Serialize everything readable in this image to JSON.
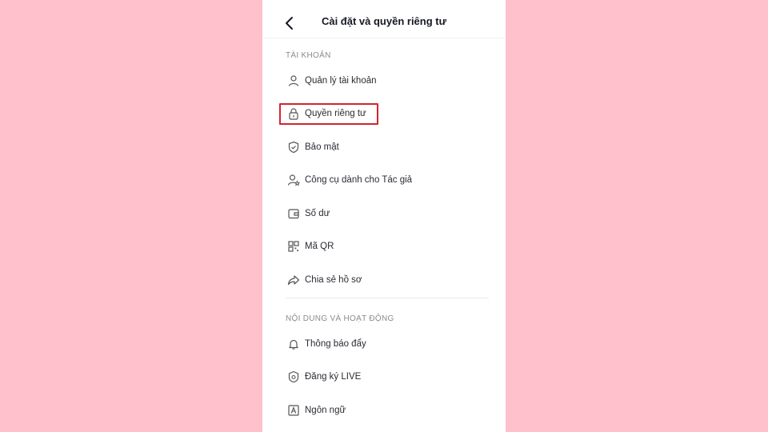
{
  "header": {
    "title": "Cài đặt và quyền riêng tư"
  },
  "sections": [
    {
      "title": "TÀI KHOẢN",
      "items": [
        {
          "label": "Quản lý tài khoản",
          "icon": "person-icon"
        },
        {
          "label": "Quyền riêng tư",
          "icon": "lock-icon"
        },
        {
          "label": "Bảo mật",
          "icon": "shield-icon"
        },
        {
          "label": "Công cụ dành cho Tác giả",
          "icon": "creator-tools-icon"
        },
        {
          "label": "Số dư",
          "icon": "wallet-icon"
        },
        {
          "label": "Mã QR",
          "icon": "qr-code-icon"
        },
        {
          "label": "Chia sẻ hồ sơ",
          "icon": "share-icon"
        }
      ]
    },
    {
      "title": "NỘI DUNG VÀ HOẠT ĐỘNG",
      "items": [
        {
          "label": "Thông báo đẩy",
          "icon": "bell-icon"
        },
        {
          "label": "Đăng ký LIVE",
          "icon": "live-badge-icon"
        },
        {
          "label": "Ngôn ngữ",
          "icon": "language-icon"
        }
      ]
    }
  ],
  "colors": {
    "background": "#ffc1cb",
    "highlight": "#d2242e"
  }
}
